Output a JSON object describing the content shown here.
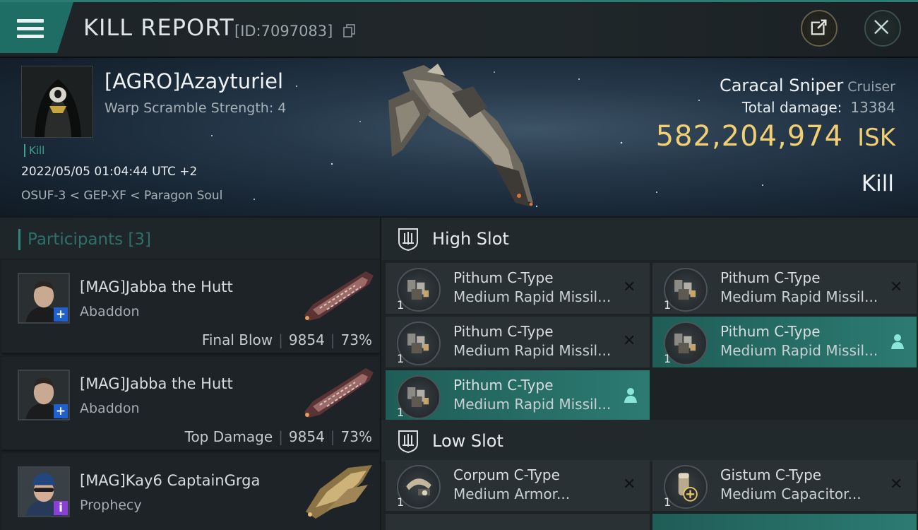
{
  "header": {
    "title": "KILL REPORT",
    "report_id": "[ID:7097083]",
    "icons": {
      "menu": "hamburger-menu-icon",
      "copy": "copy-icon",
      "share": "share-export-icon",
      "close": "close-icon"
    }
  },
  "victim": {
    "name": "[AGRO]Azayturiel",
    "warp_scramble": "Warp Scramble Strength: 4",
    "tag": "Kill",
    "timestamp": "2022/05/05 01:04:44 UTC +2",
    "location": "OSUF-3 < GEP-XF < Paragon Soul",
    "ship_name": "Caracal Sniper",
    "ship_class": "Cruiser",
    "damage_label": "Total damage:",
    "damage_value": "13384",
    "isk_value": "582,204,974",
    "isk_unit": "ISK",
    "result": "Kill"
  },
  "participants": {
    "title": "Participants",
    "count": "[3]",
    "rows": [
      {
        "name": "[MAG]Jabba the Hutt",
        "ship": "Abaddon",
        "role": "Final Blow",
        "damage": "9854",
        "percent": "73%",
        "badge": "+",
        "badge_color": "#1f5fd0"
      },
      {
        "name": "[MAG]Jabba the Hutt",
        "ship": "Abaddon",
        "role": "Top Damage",
        "damage": "9854",
        "percent": "73%",
        "badge": "+",
        "badge_color": "#1f5fd0"
      },
      {
        "name": "[MAG]Kay6 CaptainGrga",
        "ship": "Prophecy",
        "role": "",
        "damage": "",
        "percent": "",
        "badge": "i",
        "badge_color": "#8a3fd6"
      }
    ]
  },
  "fitting": {
    "high_slot": {
      "title": "High Slot",
      "modules": [
        {
          "name": "Pithum C-Type",
          "sub": "Medium Rapid Missil...",
          "qty": "1",
          "state": "destroyed"
        },
        {
          "name": "Pithum C-Type",
          "sub": "Medium Rapid Missil...",
          "qty": "1",
          "state": "destroyed"
        },
        {
          "name": "Pithum C-Type",
          "sub": "Medium Rapid Missil...",
          "qty": "1",
          "state": "destroyed"
        },
        {
          "name": "Pithum C-Type",
          "sub": "Medium Rapid Missil...",
          "qty": "1",
          "state": "dropped"
        },
        {
          "name": "Pithum C-Type",
          "sub": "Medium Rapid Missil...",
          "qty": "1",
          "state": "dropped"
        }
      ]
    },
    "low_slot": {
      "title": "Low Slot",
      "modules": [
        {
          "name": "Corpum C-Type",
          "sub": "Medium Armor...",
          "qty": "1",
          "state": "destroyed"
        },
        {
          "name": "Gistum C-Type",
          "sub": "Medium Capacitor...",
          "qty": "1",
          "state": "destroyed"
        }
      ]
    }
  },
  "colors": {
    "accent": "#2b7d74",
    "isk": "#f1cf72",
    "fitted": "#2c7b72"
  }
}
